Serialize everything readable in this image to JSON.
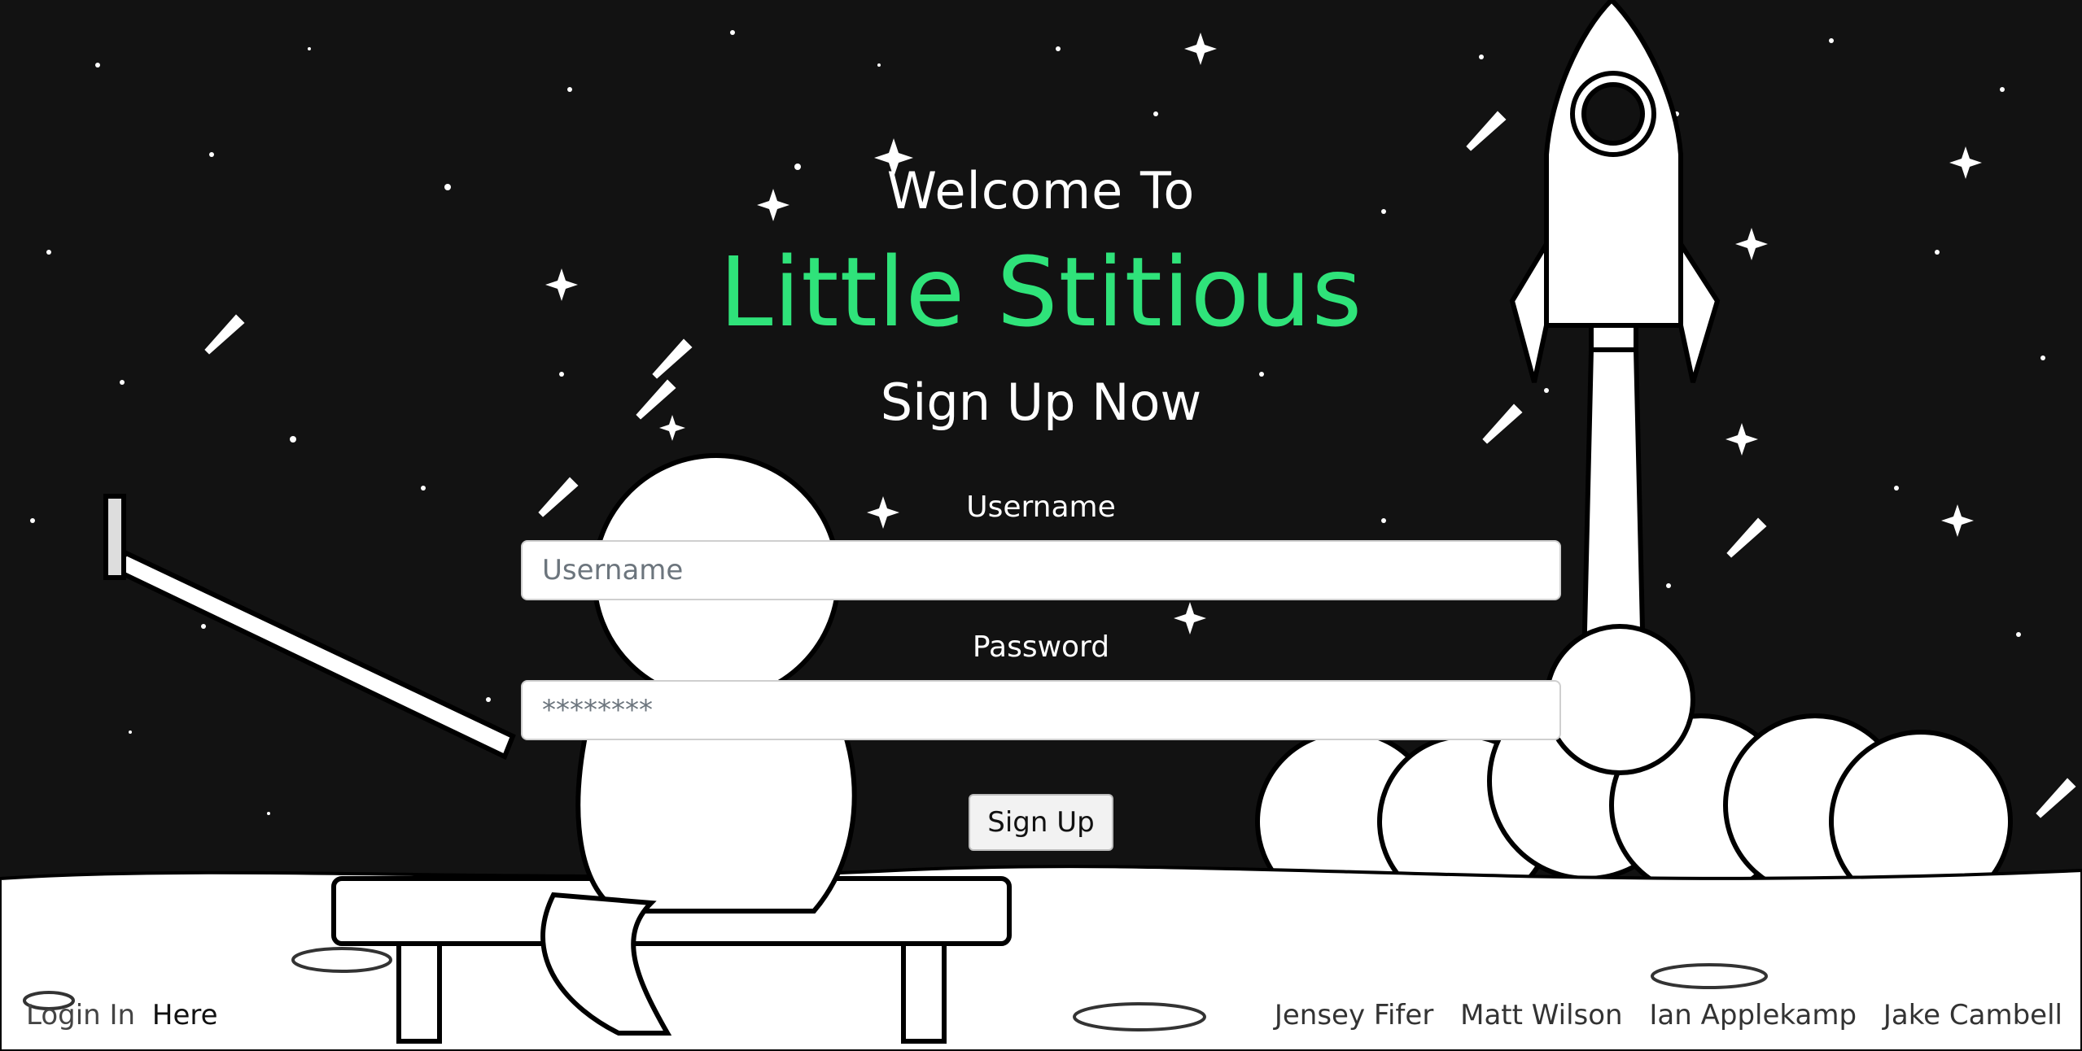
{
  "header": {
    "welcome": "Welcome To",
    "brand": "Little Stitious",
    "subtitle": "Sign Up Now"
  },
  "form": {
    "username_label": "Username",
    "username_placeholder": "Username",
    "password_label": "Password",
    "password_placeholder": "********",
    "submit_label": "Sign Up"
  },
  "footer": {
    "login_prefix": "Login In",
    "login_link": "Here",
    "credits": [
      "Jensey Fifer",
      "Matt Wilson",
      "Ian Applekamp",
      "Jake Cambell"
    ]
  },
  "colors": {
    "brand": "#2fe37a",
    "background": "#121212"
  },
  "icons": [
    "rocket-icon",
    "astronaut-illustration",
    "star-icon"
  ]
}
